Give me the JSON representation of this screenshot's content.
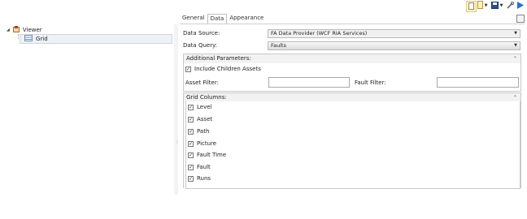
{
  "toolbar": {
    "page_icon": "page-icon",
    "document_icon": "document-icon",
    "save_icon": "save-icon",
    "tools_icon": "tools-icon",
    "play_icon": "play-icon",
    "dropdown_glyph": "▼"
  },
  "tree": {
    "expander": "◢",
    "root_label": "Viewer",
    "child_label": "Grid"
  },
  "tabs": [
    {
      "label": "General"
    },
    {
      "label": "Data"
    },
    {
      "label": "Appearance"
    }
  ],
  "data_tab": {
    "data_source_label": "Data Source:",
    "data_source_value": "FA Data Provider (WCF RIA Services)",
    "data_query_label": "Data Query:",
    "data_query_value": "Faults",
    "additional_params": {
      "title": "Additional Parameters:",
      "include_children_label": "Include Children Assets",
      "include_children_checked": true,
      "asset_filter_label": "Asset Filter:",
      "asset_filter_value": "",
      "fault_filter_label": "Fault Filter:",
      "fault_filter_value": ""
    },
    "grid_columns": {
      "title": "Grid Columns:",
      "items": [
        {
          "label": "Level",
          "checked": true
        },
        {
          "label": "Asset",
          "checked": true
        },
        {
          "label": "Path",
          "checked": true
        },
        {
          "label": "Picture",
          "checked": true
        },
        {
          "label": "Fault Time",
          "checked": true
        },
        {
          "label": "Fault",
          "checked": true
        },
        {
          "label": "Runs",
          "checked": true
        }
      ]
    }
  },
  "glyphs": {
    "check": "✓",
    "collapse": "⌃",
    "combo_arrow": "▼"
  },
  "colors": {
    "selection_bg": "#eef2f7",
    "accent_blue": "#1e74c8"
  }
}
